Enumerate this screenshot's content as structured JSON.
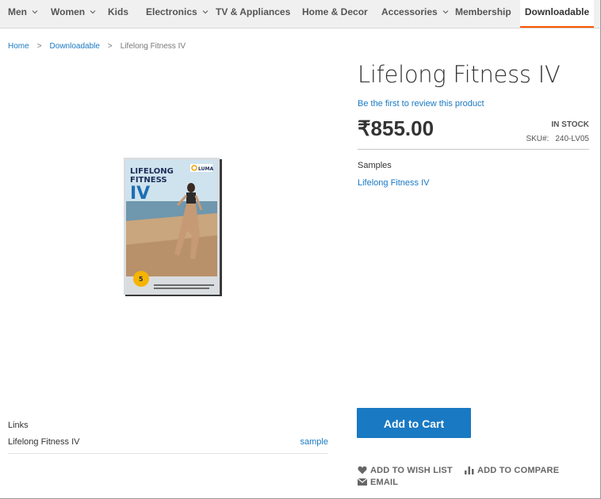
{
  "nav": {
    "items": [
      {
        "label": "Men",
        "has_submenu": true
      },
      {
        "label": "Women",
        "has_submenu": true
      },
      {
        "label": "Kids",
        "has_submenu": false
      },
      {
        "label": "Electronics",
        "has_submenu": true
      },
      {
        "label": "TV & Appliances",
        "has_submenu": false
      },
      {
        "label": "Home & Decor",
        "has_submenu": false
      },
      {
        "label": "Accessories",
        "has_submenu": true
      },
      {
        "label": "Membership",
        "has_submenu": false
      },
      {
        "label": "Downloadable",
        "has_submenu": false,
        "active": true
      }
    ]
  },
  "breadcrumbs": {
    "home": "Home",
    "category": "Downloadable",
    "current": "Lifelong Fitness IV",
    "separator": ">"
  },
  "product": {
    "title": "Lifelong Fitness IV",
    "review_link": "Be the first to review this product",
    "price": "₹855.00",
    "stock": "IN STOCK",
    "sku_label": "SKU#:",
    "sku_value": "240-LV05",
    "image": {
      "cover_title_line1": "LIFELONG",
      "cover_title_line2": "FITNESS",
      "cover_title_line3": "IV",
      "cover_brand": "LUMA",
      "cover_badge": "5"
    }
  },
  "samples": {
    "title": "Samples",
    "link": "Lifelong Fitness IV"
  },
  "links": {
    "title": "Links",
    "item_label": "Lifelong Fitness IV",
    "sample_link": "sample"
  },
  "actions": {
    "add_to_cart": "Add to Cart",
    "wishlist": "ADD TO WISH LIST",
    "compare": "ADD TO COMPARE",
    "email": "EMAIL"
  },
  "colors": {
    "accent": "#1979c3",
    "nav_active_underline": "#ff5501",
    "nav_bg": "#f0f0f0"
  }
}
